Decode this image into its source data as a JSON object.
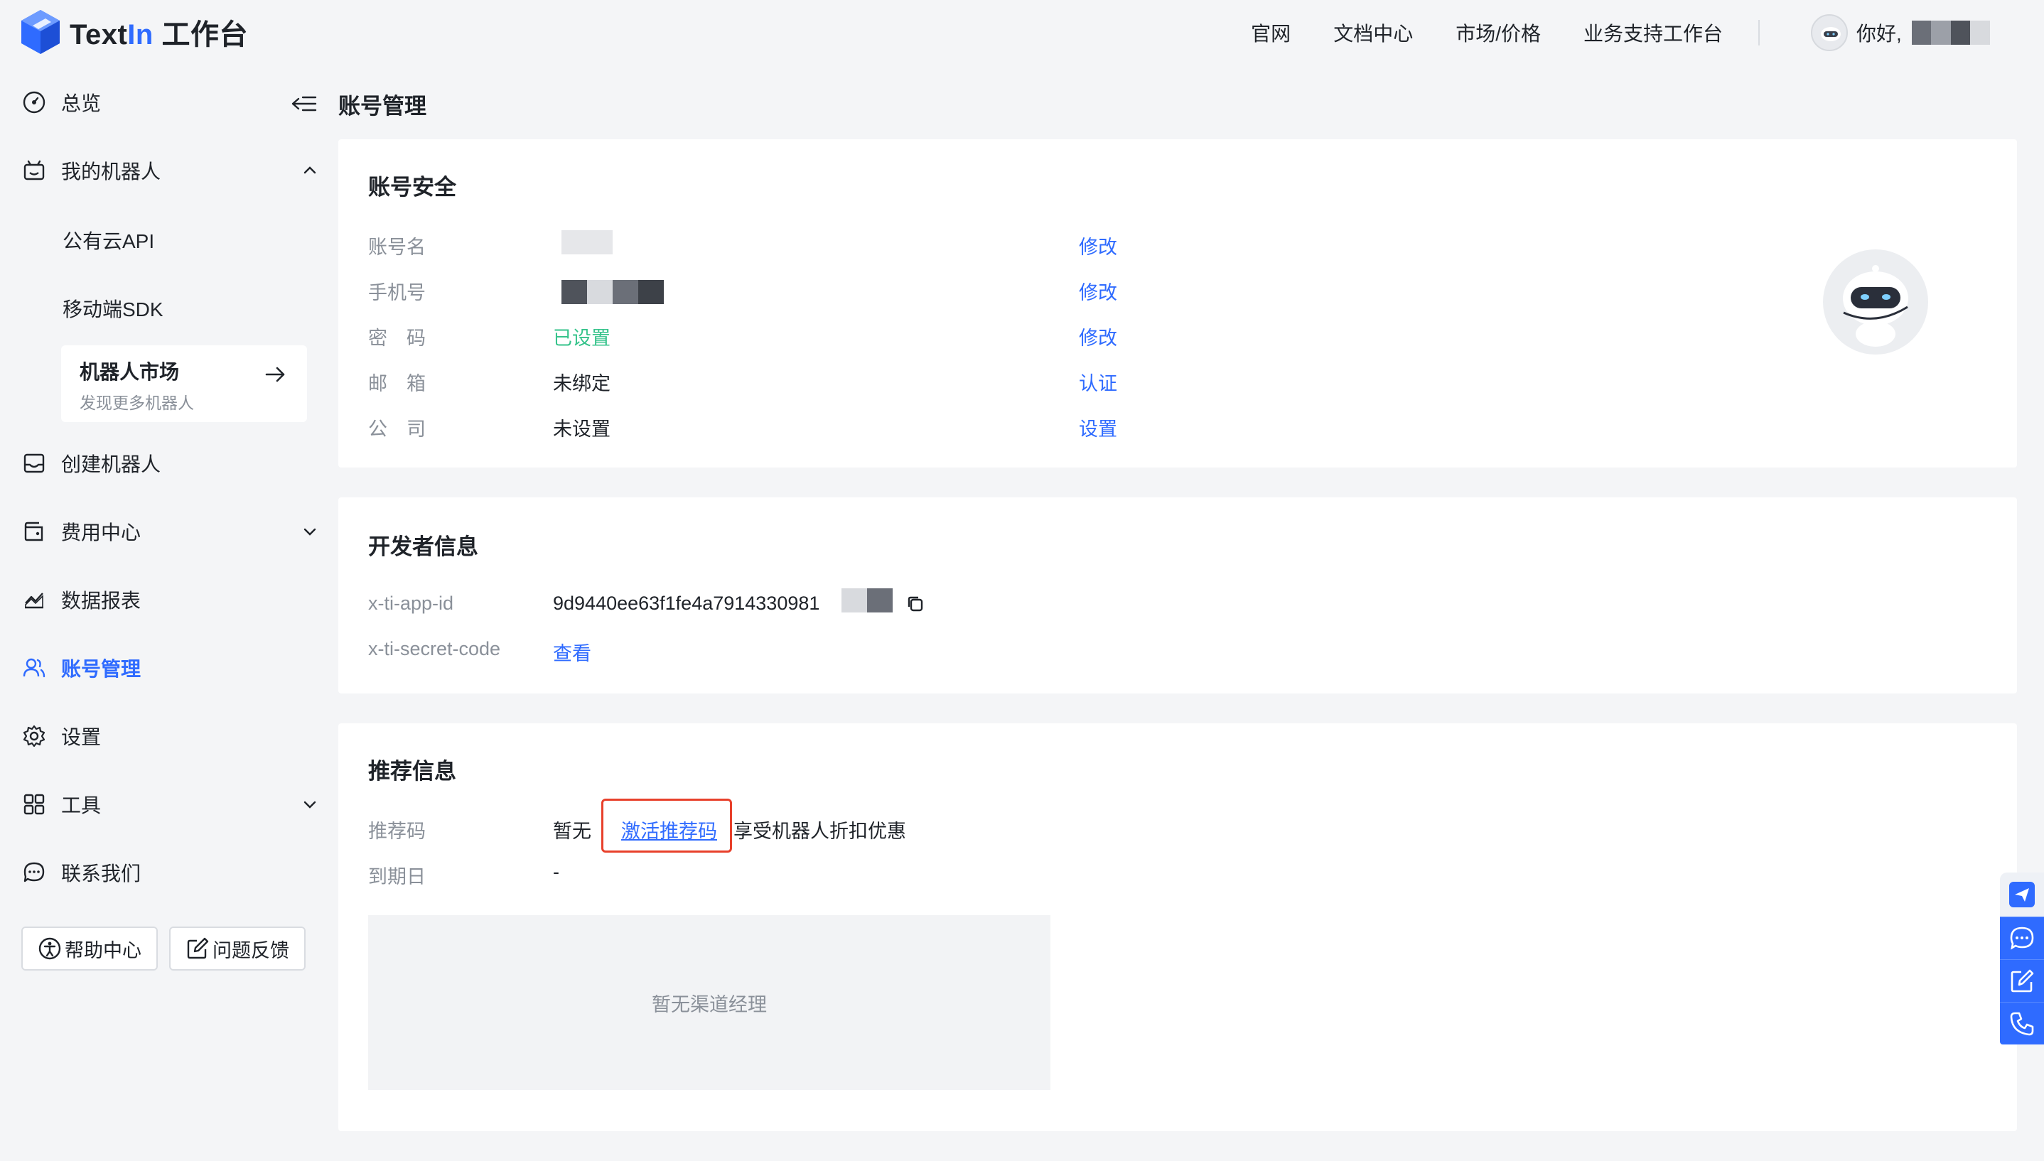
{
  "header": {
    "logo_text_a": "Text",
    "logo_text_b": "In",
    "logo_text_c": " 工作台",
    "nav": [
      "官网",
      "文档中心",
      "市场/价格",
      "业务支持工作台"
    ],
    "greeting": "你好,"
  },
  "sidebar": {
    "overview": "总览",
    "my_robots": "我的机器人",
    "public_api": "公有云API",
    "mobile_sdk": "移动端SDK",
    "market_title": "机器人市场",
    "market_sub": "发现更多机器人",
    "create_robot": "创建机器人",
    "billing": "费用中心",
    "reports": "数据报表",
    "account": "账号管理",
    "settings": "设置",
    "tools": "工具",
    "contact": "联系我们",
    "help_center": "帮助中心",
    "feedback": "问题反馈"
  },
  "page": {
    "title": "账号管理"
  },
  "security": {
    "title": "账号安全",
    "rows": [
      {
        "label": "账号名",
        "value": "",
        "action": "修改"
      },
      {
        "label": "手机号",
        "value": "",
        "action": "修改"
      },
      {
        "label": "密　码",
        "value": "已设置",
        "action": "修改"
      },
      {
        "label": "邮　箱",
        "value": "未绑定",
        "action": "认证"
      },
      {
        "label": "公　司",
        "value": "未设置",
        "action": "设置"
      }
    ]
  },
  "developer": {
    "title": "开发者信息",
    "app_id_label": "x-ti-app-id",
    "app_id_value": "9d9440ee63f1fe4a7914330981",
    "secret_label": "x-ti-secret-code",
    "secret_action": "查看"
  },
  "referral": {
    "title": "推荐信息",
    "code_label": "推荐码",
    "code_value": "暂无",
    "activate_link": "激活推荐码",
    "activate_suffix": "享受机器人折扣优惠",
    "expiry_label": "到期日",
    "expiry_value": "-",
    "manager_empty": "暂无渠道经理"
  },
  "colors": {
    "primary": "#2f6bff",
    "success": "#36c38b",
    "highlight": "#e8402b"
  }
}
